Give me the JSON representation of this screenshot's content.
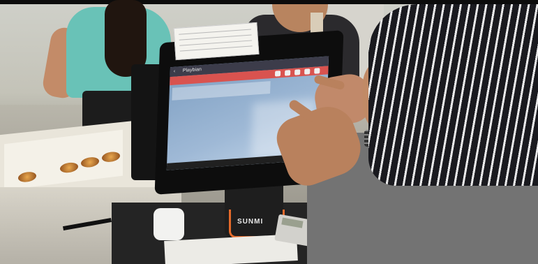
{
  "scene": {
    "description_colors": {
      "pos_stand_accent": "#e46a2a",
      "screen_app_bar": "#3c3c4a",
      "screen_tab_bar": "#d9534f",
      "hijab_stripe": "#1a1a1f"
    }
  },
  "pos_terminal": {
    "brand": "SUNMI",
    "app_bar_title": "Playbian",
    "back_icon": "back-arrow-icon"
  }
}
